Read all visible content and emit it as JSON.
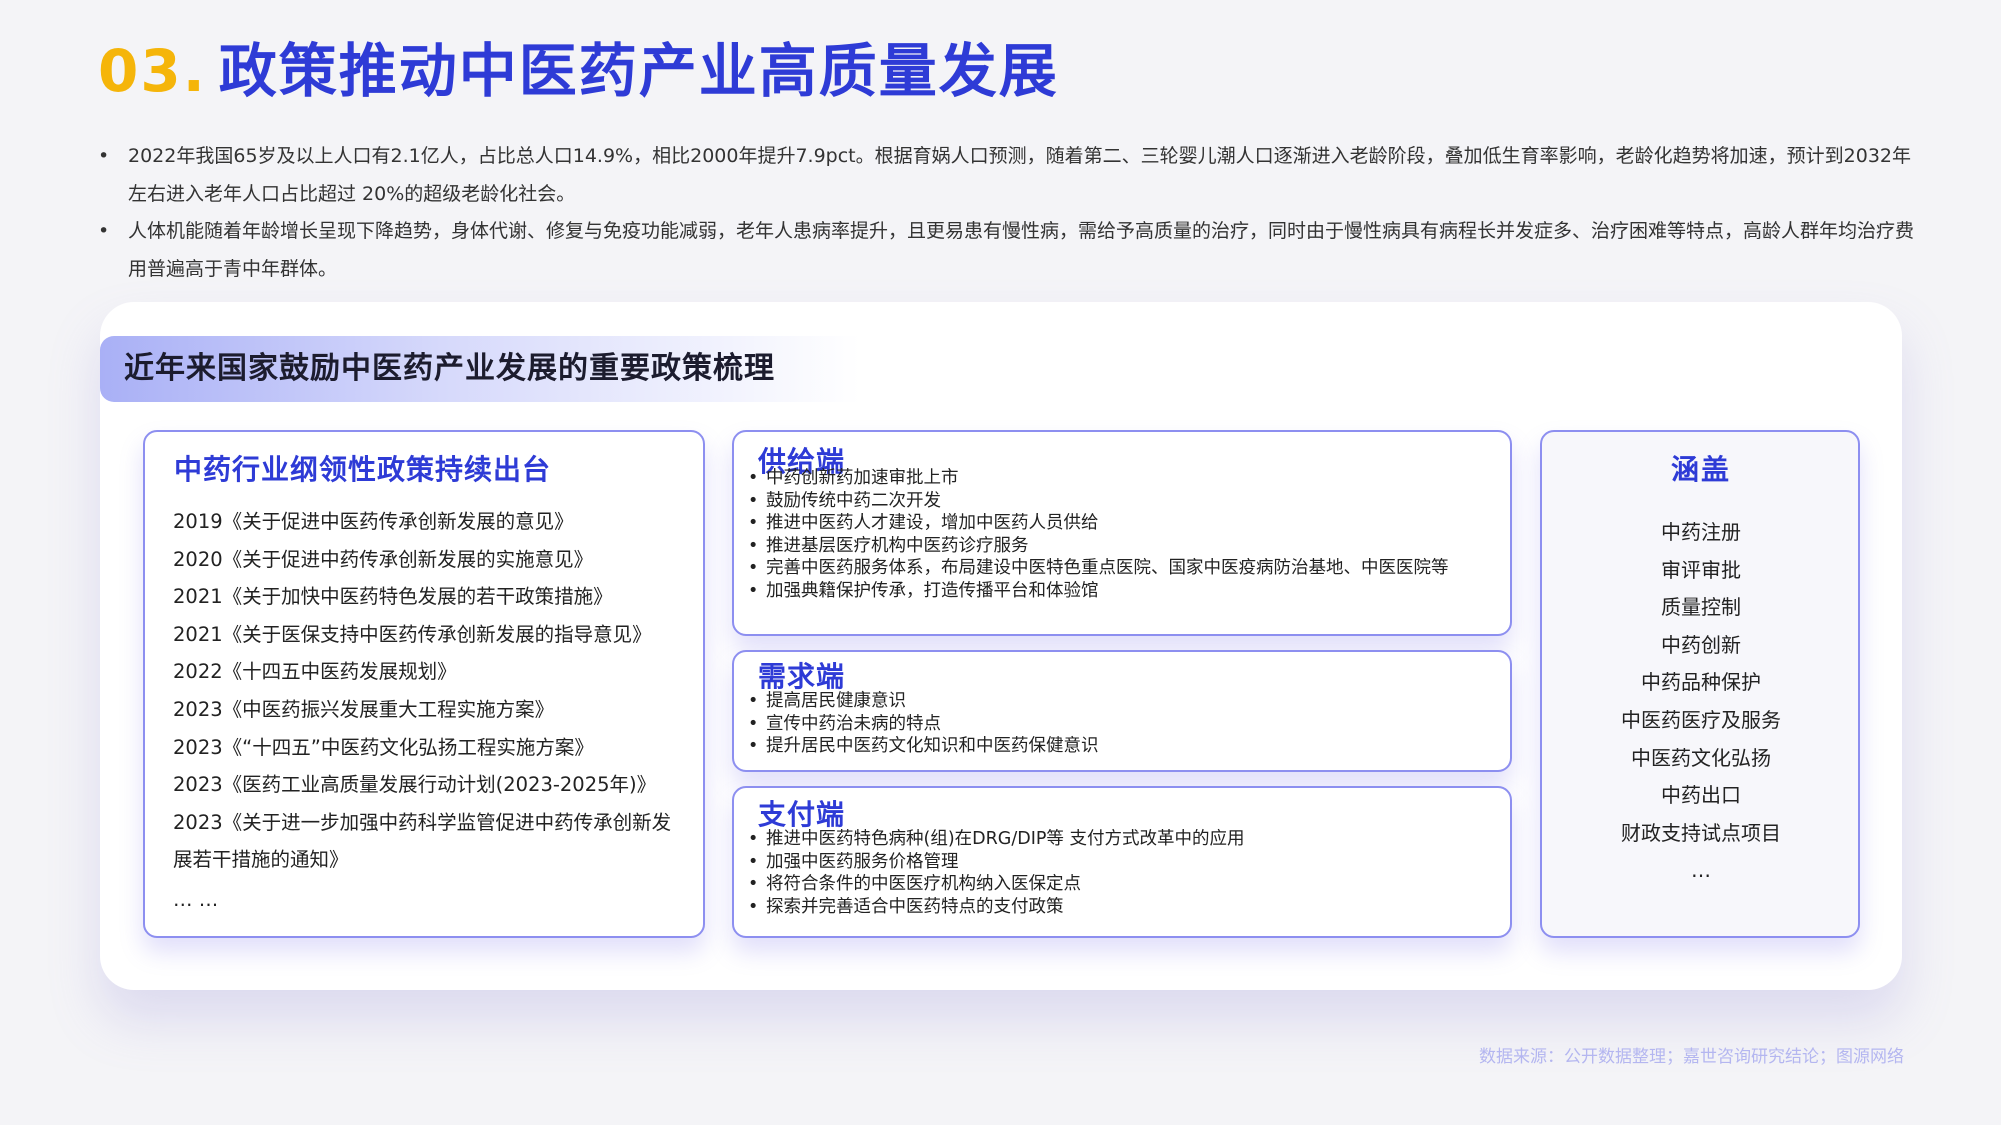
{
  "header": {
    "number": "03.",
    "title": "政策推动中医药产业高质量发展"
  },
  "bullets": [
    "2022年我国65岁及以上人口有2.1亿人，占比总人口14.9%，相比2000年提升7.9pct。根据育娲人口预测，随着第二、三轮婴儿潮人口逐渐进入老龄阶段，叠加低生育率影响，老龄化趋势将加速，预计到2032年左右进入老年人口占比超过 20%的超级老龄化社会。",
    "人体机能随着年龄增长呈现下降趋势，身体代谢、修复与免疫功能减弱，老年人患病率提升，且更易患有慢性病，需给予高质量的治疗，同时由于慢性病具有病程长并发症多、治疗困难等特点，高龄人群年均治疗费用普遍高于青中年群体。"
  ],
  "panel": {
    "heading": "近年来国家鼓励中医药产业发展的重要政策梳理",
    "left": {
      "title": "中药行业纲领性政策持续出台",
      "items": [
        "2019《关于促进中医药传承创新发展的意见》",
        "2020《关于促进中药传承创新发展的实施意见》",
        "2021《关于加快中医药特色发展的若干政策措施》",
        "2021《关于医保支持中医药传承创新发展的指导意见》",
        "2022《十四五中医药发展规划》",
        "2023《中医药振兴发展重大工程实施方案》",
        "2023《“十四五”中医药文化弘扬工程实施方案》",
        "2023《医药工业高质量发展行动计划(2023-2025年)》",
        "2023《关于进一步加强中药科学监管促进中药传承创新发展若干措施的通知》",
        "… …"
      ]
    },
    "supply": {
      "title": "供给端",
      "items": [
        "中药创新药加速审批上市",
        "鼓励传统中药二次开发",
        "推进中医药人才建设，增加中医药人员供给",
        "推进基层医疗机构中医药诊疗服务",
        "完善中医药服务体系，布局建设中医特色重点医院、国家中医疫病防治基地、中医医院等",
        "加强典籍保护传承，打造传播平台和体验馆"
      ]
    },
    "demand": {
      "title": "需求端",
      "items": [
        "提高居民健康意识",
        "宣传中药治未病的特点",
        "提升居民中医药文化知识和中医药保健意识"
      ]
    },
    "payment": {
      "title": "支付端",
      "items": [
        "推进中医药特色病种(组)在DRG/DIP等 支付方式改革中的应用",
        "加强中医药服务价格管理",
        "将符合条件的中医医疗机构纳入医保定点",
        "探索并完善适合中医药特点的支付政策"
      ]
    },
    "coverage": {
      "title": "涵盖",
      "items": [
        "中药注册",
        "审评审批",
        "质量控制",
        "中药创新",
        "中药品种保护",
        "中医药医疗及服务",
        "中医药文化弘扬",
        "中药出口",
        "财政支持试点项目",
        "…"
      ]
    }
  },
  "source": "数据来源：公开数据整理；嘉世咨询研究结论；图源网络"
}
